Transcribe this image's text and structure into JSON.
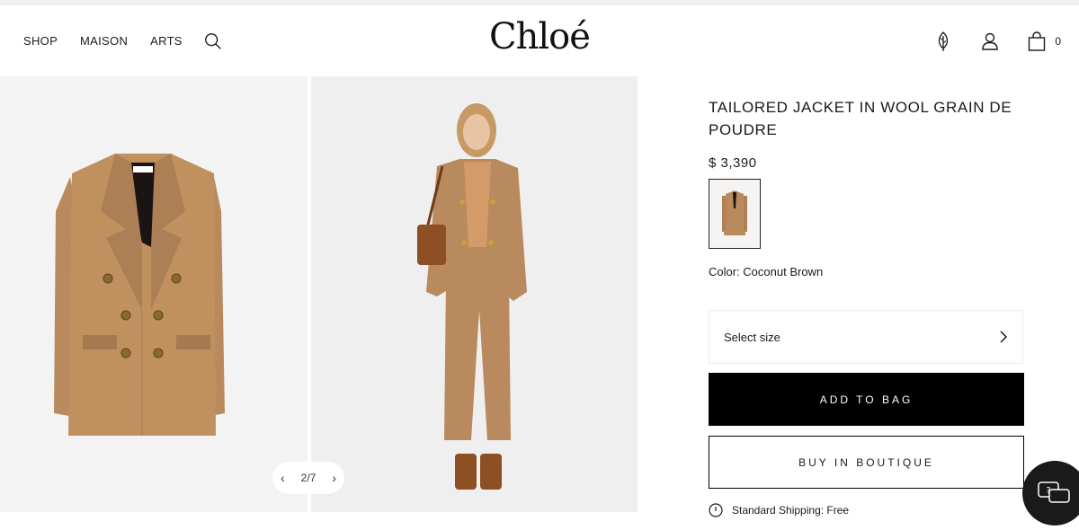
{
  "nav": {
    "items": [
      {
        "label": "SHOP"
      },
      {
        "label": "MAISON"
      },
      {
        "label": "ARTS"
      }
    ],
    "search_icon": "search-icon"
  },
  "logo": {
    "text": "Chloé"
  },
  "header_icons": {
    "sustainability": "leaf-icon",
    "account": "user-icon",
    "bag": "shopping-bag-icon",
    "bag_count": "0"
  },
  "gallery": {
    "pager": "2/7",
    "prev_icon": "chevron-left-icon",
    "next_icon": "chevron-right-icon"
  },
  "product": {
    "title": "TAILORED JACKET IN WOOL GRAIN DE POUDRE",
    "price": "$ 3,390",
    "color_label": "Color: Coconut Brown",
    "size_label": "Select size",
    "add_to_bag": "ADD TO BAG",
    "buy_in_boutique": "BUY IN BOUTIQUE",
    "shipping": "Standard Shipping: Free"
  },
  "colors": {
    "camel": "#b98a5e",
    "accent_black": "#000000"
  }
}
